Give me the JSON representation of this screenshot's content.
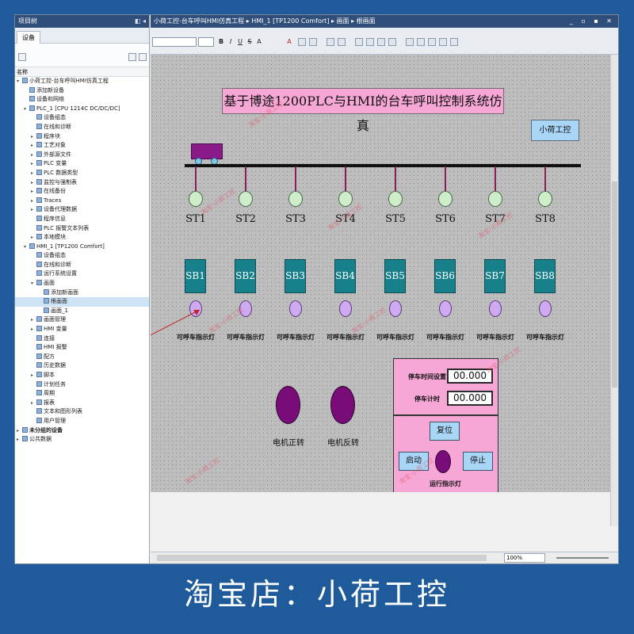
{
  "project_pane": {
    "title": "项目树",
    "tab": "设备",
    "column_header": "名称",
    "items": [
      {
        "label": "小荷工控-台车呼叫HMI仿真工程",
        "depth": 0,
        "arrow": "▾"
      },
      {
        "label": "添加新设备",
        "depth": 1,
        "arrow": ""
      },
      {
        "label": "设备和网络",
        "depth": 1,
        "arrow": ""
      },
      {
        "label": "PLC_1 [CPU 1214C DC/DC/DC]",
        "depth": 1,
        "arrow": "▾"
      },
      {
        "label": "设备组态",
        "depth": 2,
        "arrow": ""
      },
      {
        "label": "在线和诊断",
        "depth": 2,
        "arrow": ""
      },
      {
        "label": "程序块",
        "depth": 2,
        "arrow": "▸"
      },
      {
        "label": "工艺对象",
        "depth": 2,
        "arrow": "▸"
      },
      {
        "label": "外部源文件",
        "depth": 2,
        "arrow": "▸"
      },
      {
        "label": "PLC 变量",
        "depth": 2,
        "arrow": "▸"
      },
      {
        "label": "PLC 数据类型",
        "depth": 2,
        "arrow": "▸"
      },
      {
        "label": "监控与强制表",
        "depth": 2,
        "arrow": "▸"
      },
      {
        "label": "在线备份",
        "depth": 2,
        "arrow": "▸"
      },
      {
        "label": "Traces",
        "depth": 2,
        "arrow": "▸"
      },
      {
        "label": "设备代理数据",
        "depth": 2,
        "arrow": "▸"
      },
      {
        "label": "程序信息",
        "depth": 2,
        "arrow": ""
      },
      {
        "label": "PLC 报警文本列表",
        "depth": 2,
        "arrow": ""
      },
      {
        "label": "本地模块",
        "depth": 2,
        "arrow": "▸"
      },
      {
        "label": "HMI_1 [TP1200 Comfort]",
        "depth": 1,
        "arrow": "▾"
      },
      {
        "label": "设备组态",
        "depth": 2,
        "arrow": ""
      },
      {
        "label": "在线和诊断",
        "depth": 2,
        "arrow": ""
      },
      {
        "label": "运行系统设置",
        "depth": 2,
        "arrow": ""
      },
      {
        "label": "画面",
        "depth": 2,
        "arrow": "▾"
      },
      {
        "label": "添加新画面",
        "depth": 3,
        "arrow": ""
      },
      {
        "label": "根画面",
        "depth": 3,
        "arrow": "",
        "selected": true
      },
      {
        "label": "画面_1",
        "depth": 3,
        "arrow": ""
      },
      {
        "label": "画面管理",
        "depth": 2,
        "arrow": "▸"
      },
      {
        "label": "HMI 变量",
        "depth": 2,
        "arrow": "▸"
      },
      {
        "label": "连接",
        "depth": 2,
        "arrow": ""
      },
      {
        "label": "HMI 报警",
        "depth": 2,
        "arrow": ""
      },
      {
        "label": "配方",
        "depth": 2,
        "arrow": ""
      },
      {
        "label": "历史数据",
        "depth": 2,
        "arrow": ""
      },
      {
        "label": "脚本",
        "depth": 2,
        "arrow": "▸"
      },
      {
        "label": "计划任务",
        "depth": 2,
        "arrow": ""
      },
      {
        "label": "周期",
        "depth": 2,
        "arrow": ""
      },
      {
        "label": "报表",
        "depth": 2,
        "arrow": "▸"
      },
      {
        "label": "文本和图形列表",
        "depth": 2,
        "arrow": ""
      },
      {
        "label": "用户管理",
        "depth": 2,
        "arrow": ""
      },
      {
        "label": "未分组的设备",
        "depth": 0,
        "arrow": "▸",
        "bold": true
      },
      {
        "label": "公共数据",
        "depth": 0,
        "arrow": "▸"
      }
    ]
  },
  "editor": {
    "breadcrumb": "小荷工控-台车呼叫HMI仿真工程 ▸ HMI_1 [TP1200 Comfort] ▸ 画面 ▸ 根画面",
    "window_controls": "_ ▫ ▪ ✕",
    "font_size_value": "",
    "format_buttons": [
      "B",
      "I",
      "U",
      "S",
      "A",
      "A"
    ]
  },
  "screen": {
    "title": "基于博途1200PLC与HMI的台车呼叫控制系统仿真",
    "brand": "小荷工控",
    "stations": [
      "ST1",
      "ST2",
      "ST3",
      "ST4",
      "ST5",
      "ST6",
      "ST7",
      "ST8"
    ],
    "call_buttons": [
      "SB1",
      "SB2",
      "SB3",
      "SB4",
      "SB5",
      "SB6",
      "SB7",
      "SB8"
    ],
    "indicator_label": "可呼车指示灯",
    "motor_forward": "电机正转",
    "motor_reverse": "电机反转",
    "stop_time_label": "停车时间设置",
    "stop_timer_label": "停车计时",
    "stop_time_value": "00.000",
    "stop_timer_value": "00.000",
    "reset_label": "复位",
    "start_label": "启动",
    "stop_label": "停止",
    "run_lamp_label": "运行指示灯",
    "watermark": "淘宝:小荷工控"
  },
  "status": {
    "zoom": "100%"
  },
  "footer": "淘宝店：小荷工控",
  "colors": {
    "pink_panel": "#f7a7d6",
    "teal_button": "#17808b",
    "blue_button": "#a9d5f7",
    "purple_motor": "#7a0c7a",
    "outer_background": "#1f5b9b"
  }
}
